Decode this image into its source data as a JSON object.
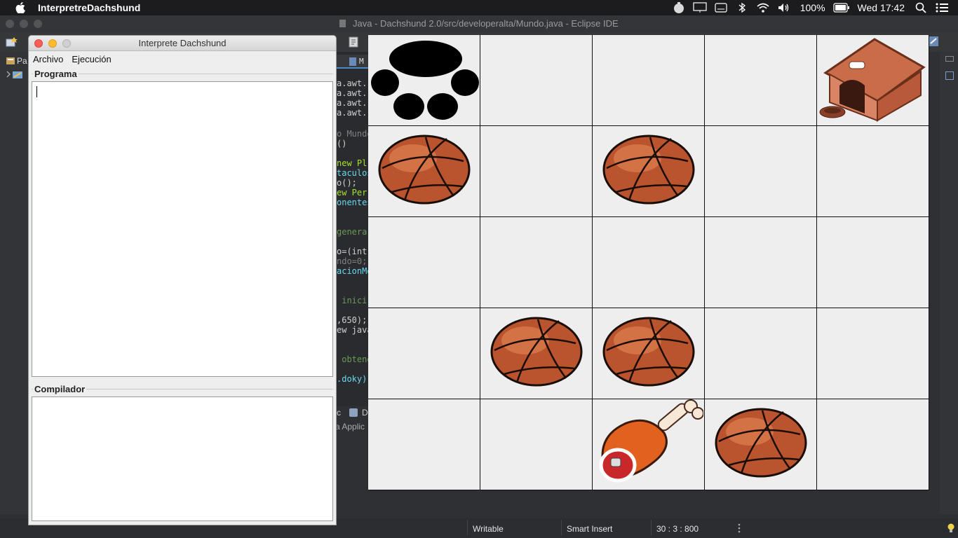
{
  "menubar": {
    "app_name": "InterpretreDachshund",
    "battery": "100%",
    "clock": "Wed 17:42"
  },
  "eclipse": {
    "window_title": "Java - Dachshund 2.0/src/developeralta/Mundo.java - Eclipse IDE",
    "left_tab_label": "Pa",
    "editor_tab_label": "M",
    "code_lines": [
      "a.awt.",
      "a.awt.",
      "a.awt.",
      "a.awt.",
      "o Mundo",
      "()",
      "new Pl",
      "taculos",
      "o();",
      "ew Per",
      "onentes",
      "genera",
      "o=(int",
      "ndo=0;",
      "acionMe",
      " inici",
      ",650);",
      "ew java",
      " obtene",
      ".doky)"
    ],
    "bottom_tabs": [
      "c",
      "D"
    ],
    "bottom_text": "a Applic",
    "status": {
      "writable": "Writable",
      "insert_mode": "Smart Insert",
      "position": "30 : 3 : 800"
    }
  },
  "interpreter": {
    "title": "Interprete Dachshund",
    "menu": [
      "Archivo",
      "Ejecución"
    ],
    "programa_label": "Programa",
    "compilador_label": "Compilador",
    "programa_text": "",
    "compilador_text": ""
  },
  "board": {
    "rows": 5,
    "cols": 5,
    "cells": [
      [
        "paw",
        "",
        "",
        "",
        "doghouse"
      ],
      [
        "ball",
        "",
        "ball",
        "",
        ""
      ],
      [
        "",
        "",
        "",
        "",
        ""
      ],
      [
        "",
        "ball",
        "ball",
        "",
        ""
      ],
      [
        "",
        "",
        "meat",
        "ball",
        ""
      ]
    ]
  }
}
